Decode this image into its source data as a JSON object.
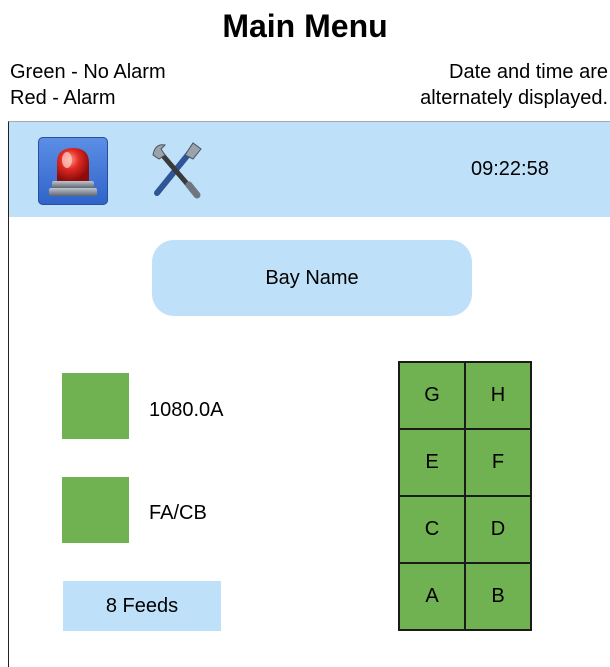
{
  "page": {
    "title": "Main Menu",
    "legend": {
      "green": "Green - No Alarm",
      "red": "Red - Alarm"
    },
    "note": {
      "line1": "Date and time are",
      "line2": "alternately displayed."
    }
  },
  "toolbar": {
    "clock": "09:22:58",
    "alarm_icon": "alarm-beacon-icon",
    "tools_icon": "tools-icon"
  },
  "main": {
    "bay_name": "Bay Name",
    "indicators": [
      {
        "label": "1080.0A",
        "color": "#70b152"
      },
      {
        "label": "FA/CB",
        "color": "#70b152"
      }
    ],
    "feeds_button": "8 Feeds",
    "feeders": [
      [
        "G",
        "H"
      ],
      [
        "E",
        "F"
      ],
      [
        "C",
        "D"
      ],
      [
        "A",
        "B"
      ]
    ]
  },
  "colors": {
    "panel": "#bee0f8",
    "ok_green": "#70b152",
    "alarm_button_blue": "#3f73d8"
  }
}
